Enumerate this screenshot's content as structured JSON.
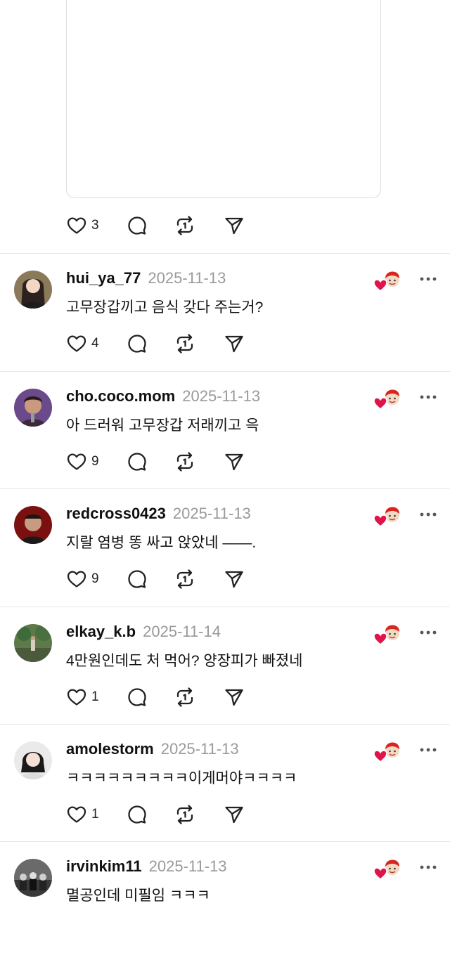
{
  "top_post": {
    "like_count": "3"
  },
  "comments": [
    {
      "username": "hui_ya_77",
      "date": "2025-11-13",
      "text": "고무장갑끼고 음식 갖다 주는거?",
      "like_count": "4"
    },
    {
      "username": "cho.coco.mom",
      "date": "2025-11-13",
      "text": "아 드러워 고무장갑 저래끼고 윽",
      "like_count": "9"
    },
    {
      "username": "redcross0423",
      "date": "2025-11-13",
      "text": "지랄 염병 똥 싸고 앉았네 ——.",
      "like_count": "9"
    },
    {
      "username": "elkay_k.b",
      "date": "2025-11-14",
      "text": "4만원인데도 처 먹어? 양장피가 빠졌네",
      "like_count": "1"
    },
    {
      "username": "amolestorm",
      "date": "2025-11-13",
      "text": "ㅋㅋㅋㅋㅋㅋㅋㅋㅋ이게머야ㅋㅋㅋㅋ",
      "like_count": "1"
    },
    {
      "username": "irvinkim11",
      "date": "2025-11-13",
      "text": "멸공인데 미필임 ㅋㅋㅋ",
      "like_count": ""
    }
  ],
  "icons": {
    "like": "heart-icon",
    "reply": "speech-bubble-icon",
    "repost": "repost-icon",
    "share": "send-icon",
    "more": "more-dots-icon",
    "author_liked": "author-liked-heart-icon"
  },
  "colors": {
    "divider": "#e6e6e6",
    "date": "#9a9a9a",
    "author_heart": "#e0134a"
  }
}
